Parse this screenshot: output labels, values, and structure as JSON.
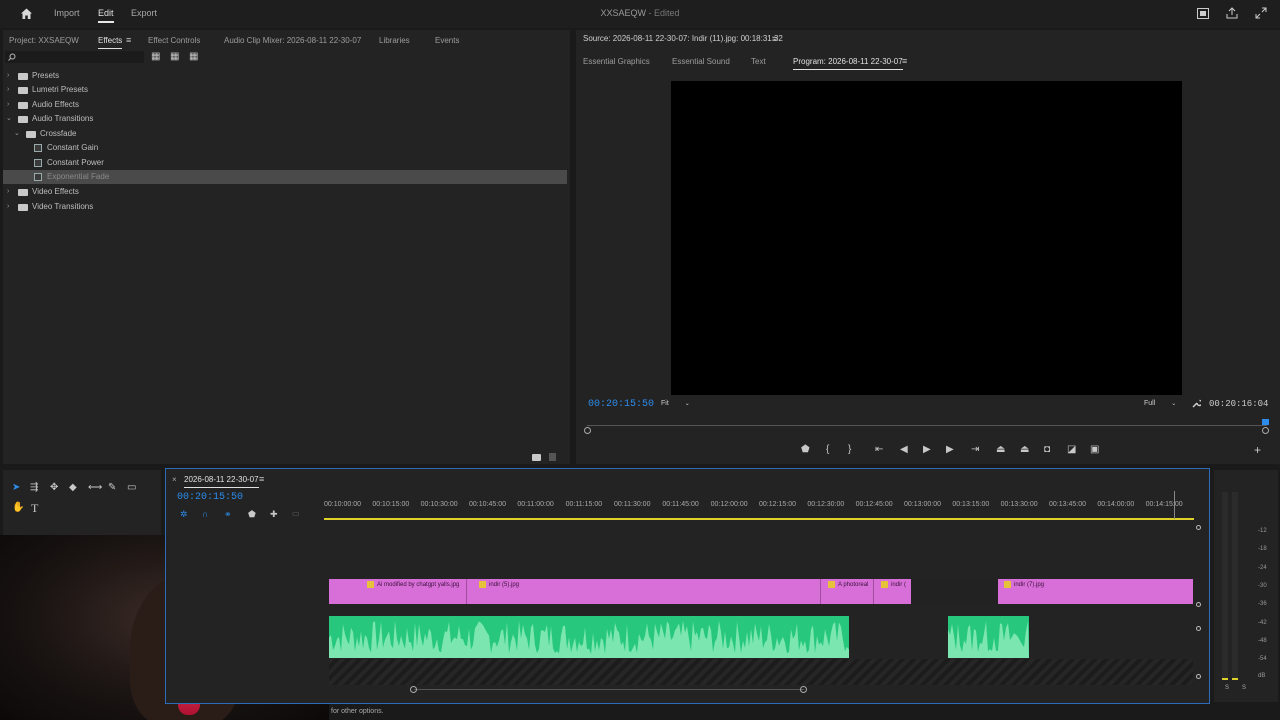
{
  "app": {
    "nav": [
      "Import",
      "Edit",
      "Export"
    ],
    "active_nav": "Edit",
    "title": "XXSAEQW",
    "title_status": "- Edited"
  },
  "left_panel": {
    "tabs": [
      "Project: XXSAEQW",
      "Effects",
      "Effect Controls",
      "Audio Clip Mixer: 2026-08-11 22-30-07",
      "Libraries",
      "Events"
    ],
    "active_tab": "Effects",
    "search_placeholder": "",
    "tree": [
      {
        "label": "Presets",
        "level": 0,
        "expanded": false,
        "type": "folder"
      },
      {
        "label": "Lumetri Presets",
        "level": 0,
        "expanded": false,
        "type": "folder"
      },
      {
        "label": "Audio Effects",
        "level": 0,
        "expanded": false,
        "type": "folder"
      },
      {
        "label": "Audio Transitions",
        "level": 0,
        "expanded": true,
        "type": "folder"
      },
      {
        "label": "Crossfade",
        "level": 1,
        "expanded": true,
        "type": "folder"
      },
      {
        "label": "Constant Gain",
        "level": 2,
        "type": "effect"
      },
      {
        "label": "Constant Power",
        "level": 2,
        "type": "effect"
      },
      {
        "label": "Exponential Fade",
        "level": 2,
        "type": "effect",
        "selected": true
      },
      {
        "label": "Video Effects",
        "level": 0,
        "expanded": false,
        "type": "folder"
      },
      {
        "label": "Video Transitions",
        "level": 0,
        "expanded": false,
        "type": "folder"
      }
    ]
  },
  "source": {
    "header": "Source: 2026-08-11 22-30-07: Indir (11).jpg: 00:18:31:32",
    "tabs": [
      "Essential Graphics",
      "Essential Sound",
      "Text",
      "Program: 2026-08-11 22-30-07"
    ],
    "active_tab": "Program: 2026-08-11 22-30-07"
  },
  "program": {
    "current_time": "00:20:15:50",
    "fit": "Fit",
    "quality": "Full",
    "duration": "00:20:16:04"
  },
  "timeline": {
    "sequence_name": "2026-08-11 22-30-07",
    "timecode": "00:20:15:50",
    "ruler": [
      "00:10:00:00",
      "00:10:15:00",
      "00:10:30:00",
      "00:10:45:00",
      "00:11:00:00",
      "00:11:15:00",
      "00:11:30:00",
      "00:11:45:00",
      "00:12:00:00",
      "00:12:15:00",
      "00:12:30:00",
      "00:12:45:00",
      "00:13:00:00",
      "00:13:15:00",
      "00:13:30:00",
      "00:13:45:00",
      "00:14:00:00",
      "00:14:15:00"
    ],
    "video_clips": [
      {
        "label": "Ai modified by chatgpt yalls.jpg"
      },
      {
        "label": "indir (5).jpg"
      },
      {
        "label": "A photoreal"
      },
      {
        "label": "indir ("
      },
      {
        "label": "indir (7).jpg"
      }
    ]
  },
  "meter": {
    "labels": [
      "-12",
      "-18",
      "-24",
      "-30",
      "-36",
      "-42",
      "-48",
      "-54",
      "dB"
    ],
    "solo": [
      "S",
      "S"
    ]
  },
  "status_bar": "for other options.",
  "colors": {
    "accent": "#2d8ceb",
    "video_clip": "#d86fd8",
    "audio_clip": "#27c87e",
    "playhead_timecode": "#2d8ceb"
  }
}
